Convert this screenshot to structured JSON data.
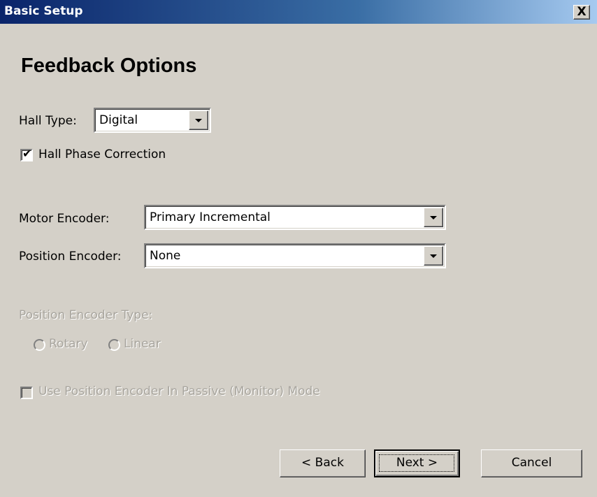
{
  "window": {
    "title": "Basic Setup",
    "close_glyph": "X"
  },
  "heading": "Feedback Options",
  "hall_type": {
    "label": "Hall Type:",
    "value": "Digital"
  },
  "hall_phase_correction": {
    "label": "Hall Phase Correction",
    "checked": true
  },
  "motor_encoder": {
    "label": "Motor Encoder:",
    "value": "Primary Incremental"
  },
  "position_encoder": {
    "label": "Position Encoder:",
    "value": "None"
  },
  "position_encoder_type": {
    "label": "Position Encoder Type:",
    "options": [
      "Rotary",
      "Linear"
    ],
    "enabled": false
  },
  "passive_mode": {
    "label": "Use Position Encoder In Passive (Monitor) Mode",
    "checked": false,
    "enabled": false
  },
  "buttons": {
    "back": "< Back",
    "next": "Next >",
    "cancel": "Cancel"
  },
  "icons": {
    "checkmark": "✔",
    "combo_arrow": "chevron-down-icon"
  },
  "colors": {
    "dialog_bg": "#d4d0c8",
    "titlebar_start": "#0a246a",
    "titlebar_end": "#a6caf0",
    "disabled_text": "#a8a59e"
  }
}
